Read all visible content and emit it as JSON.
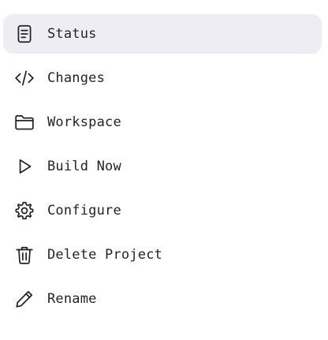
{
  "menu": {
    "items": [
      {
        "label": "Status",
        "icon": "document-icon",
        "active": true
      },
      {
        "label": "Changes",
        "icon": "code-icon",
        "active": false
      },
      {
        "label": "Workspace",
        "icon": "folder-icon",
        "active": false
      },
      {
        "label": "Build Now",
        "icon": "play-icon",
        "active": false
      },
      {
        "label": "Configure",
        "icon": "gear-icon",
        "active": false
      },
      {
        "label": "Delete Project",
        "icon": "trash-icon",
        "active": false
      },
      {
        "label": "Rename",
        "icon": "pencil-icon",
        "active": false
      }
    ],
    "active_background": "#ededf3",
    "text_color": "#1f2328"
  }
}
